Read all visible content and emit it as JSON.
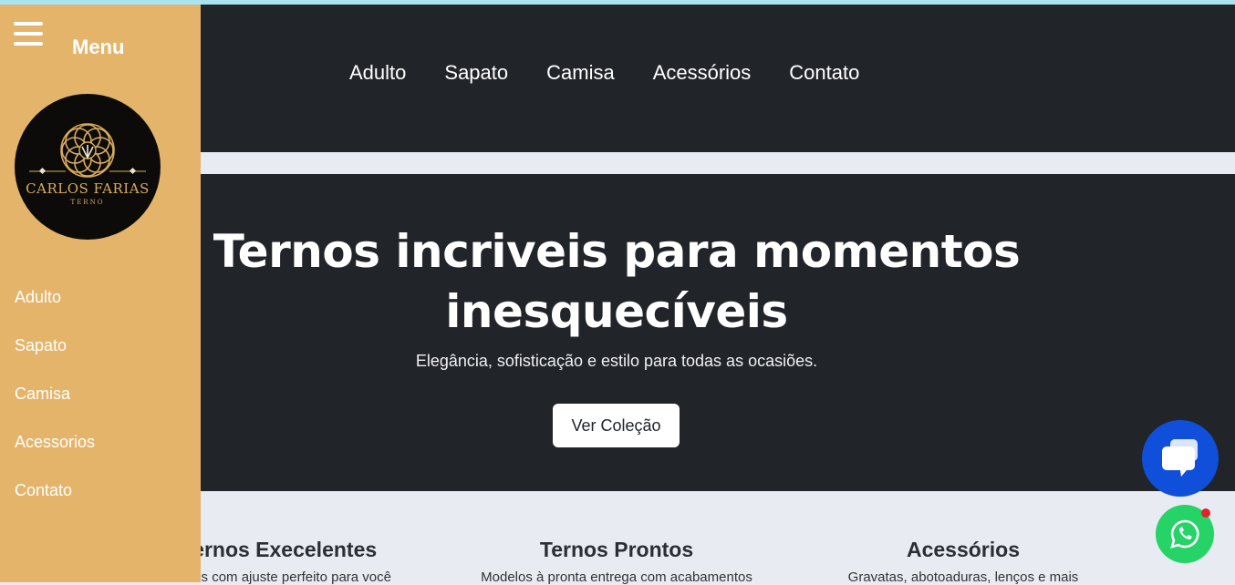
{
  "header": {
    "nav": [
      "Adulto",
      "Sapato",
      "Camisa",
      "Acessórios",
      "Contato"
    ]
  },
  "sidebar": {
    "menu_title": "Menu",
    "logo_text": "CARLOS FARIAS",
    "logo_subtext": "TERNO",
    "items": [
      "Adulto",
      "Sapato",
      "Camisa",
      "Acessorios",
      "Contato"
    ]
  },
  "hero": {
    "title": "Ternos incriveis para momentos inesquecíveis",
    "subtitle": "Elegância, sofisticação e estilo para todas as ocasiões.",
    "cta": "Ver Coleção"
  },
  "features": [
    {
      "title": "Ternos Execelentes",
      "text": "Ternos com ajuste perfeito para você"
    },
    {
      "title": "Ternos Prontos",
      "text": "Modelos à pronta entrega com acabamentos"
    },
    {
      "title": "Acessórios",
      "text": "Gravatas, abotoaduras, lenços e mais"
    }
  ],
  "colors": {
    "sidebar": "#e5b46b",
    "dark": "#212429",
    "chat_button": "#0f4fd9",
    "whatsapp": "#25d366"
  },
  "icons": {
    "menu": "hamburger-icon",
    "chat": "chat-bubbles-icon",
    "whatsapp": "whatsapp-icon"
  }
}
